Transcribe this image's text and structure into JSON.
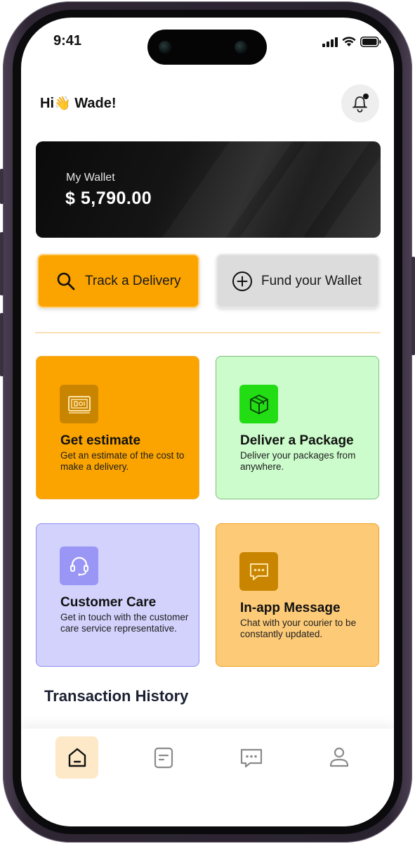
{
  "status_bar": {
    "time": "9:41"
  },
  "header": {
    "greeting_prefix": "Hi",
    "greeting_emoji": "👋",
    "greeting_name": "Wade!"
  },
  "wallet": {
    "label": "My Wallet",
    "amount": "$ 5,790.00"
  },
  "actions": [
    {
      "label": "Track a Delivery",
      "icon": "search-icon"
    },
    {
      "label": "Fund your Wallet",
      "icon": "plus-circle-icon"
    }
  ],
  "services": [
    {
      "title": "Get estimate",
      "description": "Get an estimate of the cost to make a delivery.",
      "icon": "money-icon"
    },
    {
      "title": "Deliver a Package",
      "description": "Deliver your packages from anywhere.",
      "icon": "package-icon"
    },
    {
      "title": "Customer Care",
      "description": "Get in touch with the customer care service representative.",
      "icon": "headset-icon"
    },
    {
      "title": "In-app Message",
      "description": "Chat with your courier to be constantly updated.",
      "icon": "message-icon"
    }
  ],
  "transactions": {
    "title": "Transaction History"
  },
  "tabs": [
    {
      "name": "home",
      "icon": "home-icon",
      "active": true
    },
    {
      "name": "orders",
      "icon": "document-icon",
      "active": false
    },
    {
      "name": "messages",
      "icon": "chat-icon",
      "active": false
    },
    {
      "name": "profile",
      "icon": "user-icon",
      "active": false
    }
  ],
  "colors": {
    "accent": "#fba400",
    "estimate_card": "#fba400",
    "deliver_card": "#ccfccb",
    "care_card": "#d2d2fd",
    "message_card": "#fdcb78"
  }
}
